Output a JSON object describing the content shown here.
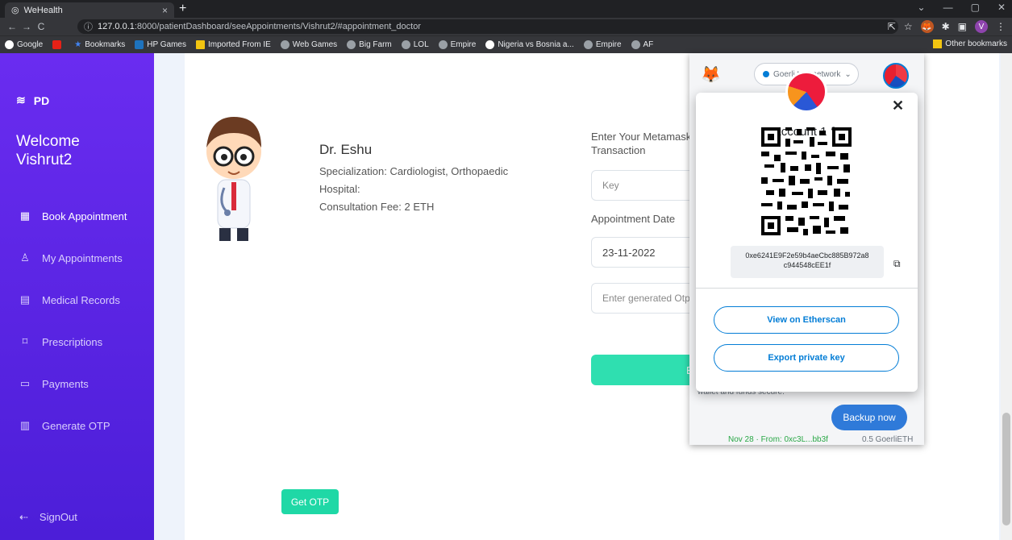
{
  "browser": {
    "tab_title": "WeHealth",
    "tab_close": "×",
    "new_tab": "+",
    "url_host": "127.0.0.1",
    "url_rest": ":8000/patientDashboard/seeAppointments/Vishrut2/#appointment_doctor",
    "window_controls": [
      "⌄",
      "—",
      "▢",
      "✕"
    ],
    "profile_initial": "V"
  },
  "bookmarks": {
    "items": [
      "Google",
      "",
      "Bookmarks",
      "HP Games",
      "Imported From IE",
      "Web Games",
      "Big Farm",
      "LOL",
      "Empire",
      "Nigeria vs Bosnia a...",
      "Empire",
      "AF"
    ],
    "other": "Other bookmarks"
  },
  "sidebar": {
    "brand": "PD",
    "welcome_line1": "Welcome",
    "welcome_line2": "Vishrut2",
    "items": [
      {
        "label": "Book Appointment",
        "icon": "grid-icon"
      },
      {
        "label": "My Appointments",
        "icon": "user-icon"
      },
      {
        "label": "Medical Records",
        "icon": "record-icon"
      },
      {
        "label": "Prescriptions",
        "icon": "bookmark-icon"
      },
      {
        "label": "Payments",
        "icon": "folder-icon"
      },
      {
        "label": "Generate OTP",
        "icon": "chart-icon"
      }
    ],
    "signout": "SignOut"
  },
  "doctor": {
    "name": "Dr. Eshu",
    "specialization": "Specialization: Cardiologist, Orthopaedic",
    "hospital": "Hospital:",
    "fee": "Consultation Fee: 2 ETH"
  },
  "form": {
    "metamask_label_1": "Enter Your Metamask",
    "metamask_label_2": "Transaction",
    "key_placeholder": "Key",
    "date_label": "Appointment Date",
    "date_value": "23-11-2022",
    "otp_placeholder": "Enter generated Otp",
    "book_label": "Bo",
    "get_otp": "Get OTP"
  },
  "metamask": {
    "network": "Goerli test network",
    "account_name": "Account 1",
    "address_line1": "0xe6241E9F2e59b4aeCbc885B972a8",
    "address_line2": "c944548cEE1f",
    "view_etherscan": "View on Etherscan",
    "export_key": "Export private key",
    "behind_text": "wallet and funds secure.",
    "backup_now": "Backup now",
    "tx_text": "Nov 28 · From: 0xc3L...bb3f",
    "tx_amount": "0.5 GoerliETH",
    "close": "✕"
  }
}
